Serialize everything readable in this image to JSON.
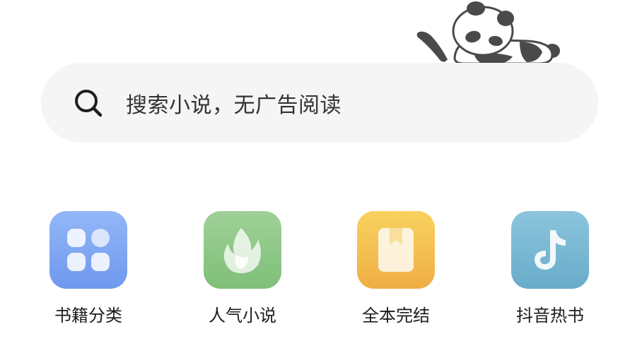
{
  "search": {
    "placeholder": "搜索小说，无广告阅读",
    "icon": "search-icon"
  },
  "mascot": {
    "icon": "sleeping-panda-icon"
  },
  "shortcuts": [
    {
      "label": "书籍分类",
      "icon": "category-grid-icon",
      "color": "#7fa6f2"
    },
    {
      "label": "人气小说",
      "icon": "flame-icon",
      "color": "#8ec887"
    },
    {
      "label": "全本完结",
      "icon": "book-icon",
      "color": "#f3c050"
    },
    {
      "label": "抖音热书",
      "icon": "music-note-icon",
      "color": "#78b7d3"
    }
  ]
}
